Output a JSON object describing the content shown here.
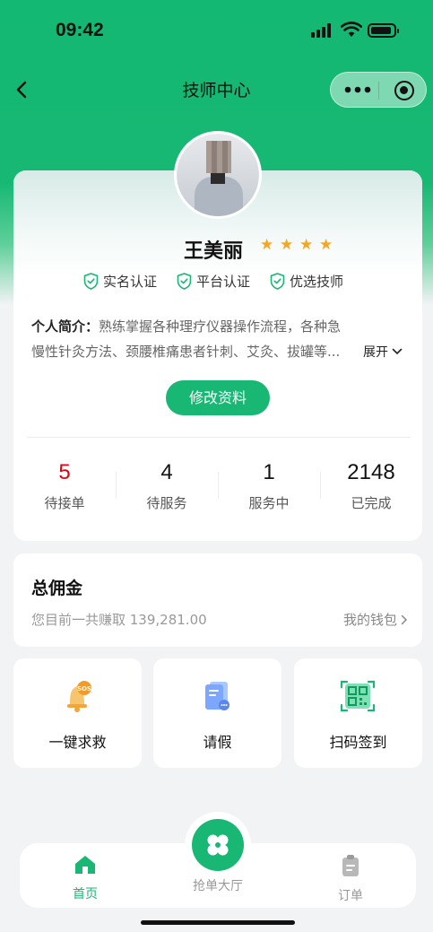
{
  "status_bar": {
    "time": "09:42"
  },
  "nav": {
    "title": "技师中心"
  },
  "profile": {
    "name": "王美丽",
    "rating": 4,
    "certifications": [
      "实名认证",
      "平台认证",
      "优选技师"
    ],
    "intro_label": "个人简介：",
    "intro_text": "熟练掌握各种理疗仪器操作流程，各种急慢性针灸方法、颈腰椎痛患者针刺、艾灸、拔罐等...",
    "expand_label": "展开",
    "edit_button": "修改资料"
  },
  "stats": [
    {
      "value": "5",
      "label": "待接单"
    },
    {
      "value": "4",
      "label": "待服务"
    },
    {
      "value": "1",
      "label": "服务中"
    },
    {
      "value": "2148",
      "label": "已完成"
    }
  ],
  "commission": {
    "title": "总佣金",
    "subtitle": "您目前一共赚取 139,281.00",
    "wallet_link": "我的钱包"
  },
  "actions": [
    {
      "label": "一键求救",
      "icon": "sos-bell-icon"
    },
    {
      "label": "请假",
      "icon": "leave-document-icon"
    },
    {
      "label": "扫码签到",
      "icon": "qr-scan-icon"
    }
  ],
  "tabbar": {
    "home": "首页",
    "grab_hall": "抢单大厅",
    "orders": "订单"
  },
  "colors": {
    "brand": "#18b874",
    "alert": "#e60012",
    "star": "#f5a623"
  }
}
